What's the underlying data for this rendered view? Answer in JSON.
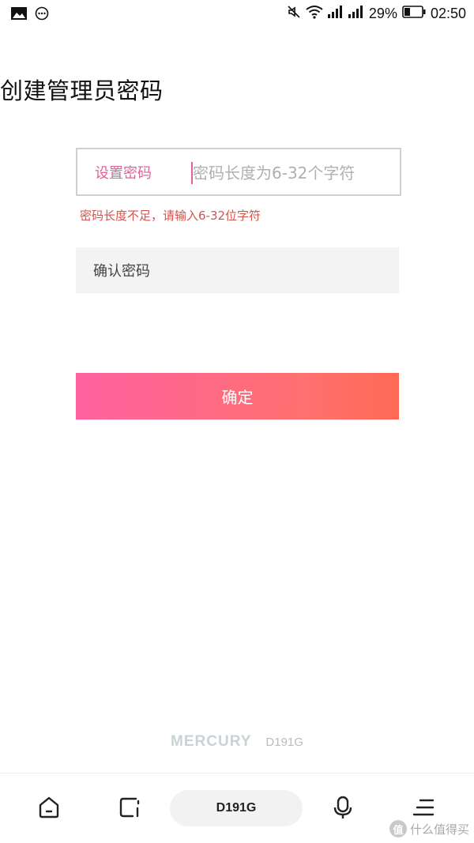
{
  "status_bar": {
    "left_icons": [
      "image-icon",
      "more-icon"
    ],
    "right_icons": [
      "mute-icon",
      "wifi-icon",
      "signal-icon",
      "signal-icon",
      "battery-icon"
    ],
    "battery_percent": "29%",
    "time": "02:50"
  },
  "page": {
    "title": "创建管理员密码"
  },
  "form": {
    "password_label": "设置密码",
    "password_placeholder": "密码长度为6-32个字符",
    "password_value": "",
    "error_message": "密码长度不足，请输入6-32位字符",
    "confirm_label": "确认密码",
    "confirm_value": "",
    "submit_label": "确定"
  },
  "footer": {
    "brand": "MERCURY",
    "model": "D191G"
  },
  "nav": {
    "items": [
      "home-icon",
      "window-icon",
      "D191G",
      "mic-icon",
      "menu-icon"
    ],
    "center_label": "D191G"
  },
  "watermark": {
    "badge": "值",
    "text": "什么值得买"
  },
  "colors": {
    "accent_pink": "#e0629a",
    "error_red": "#d0554c",
    "button_gradient_start": "#ff62a0",
    "button_gradient_end": "#ff6a55"
  }
}
